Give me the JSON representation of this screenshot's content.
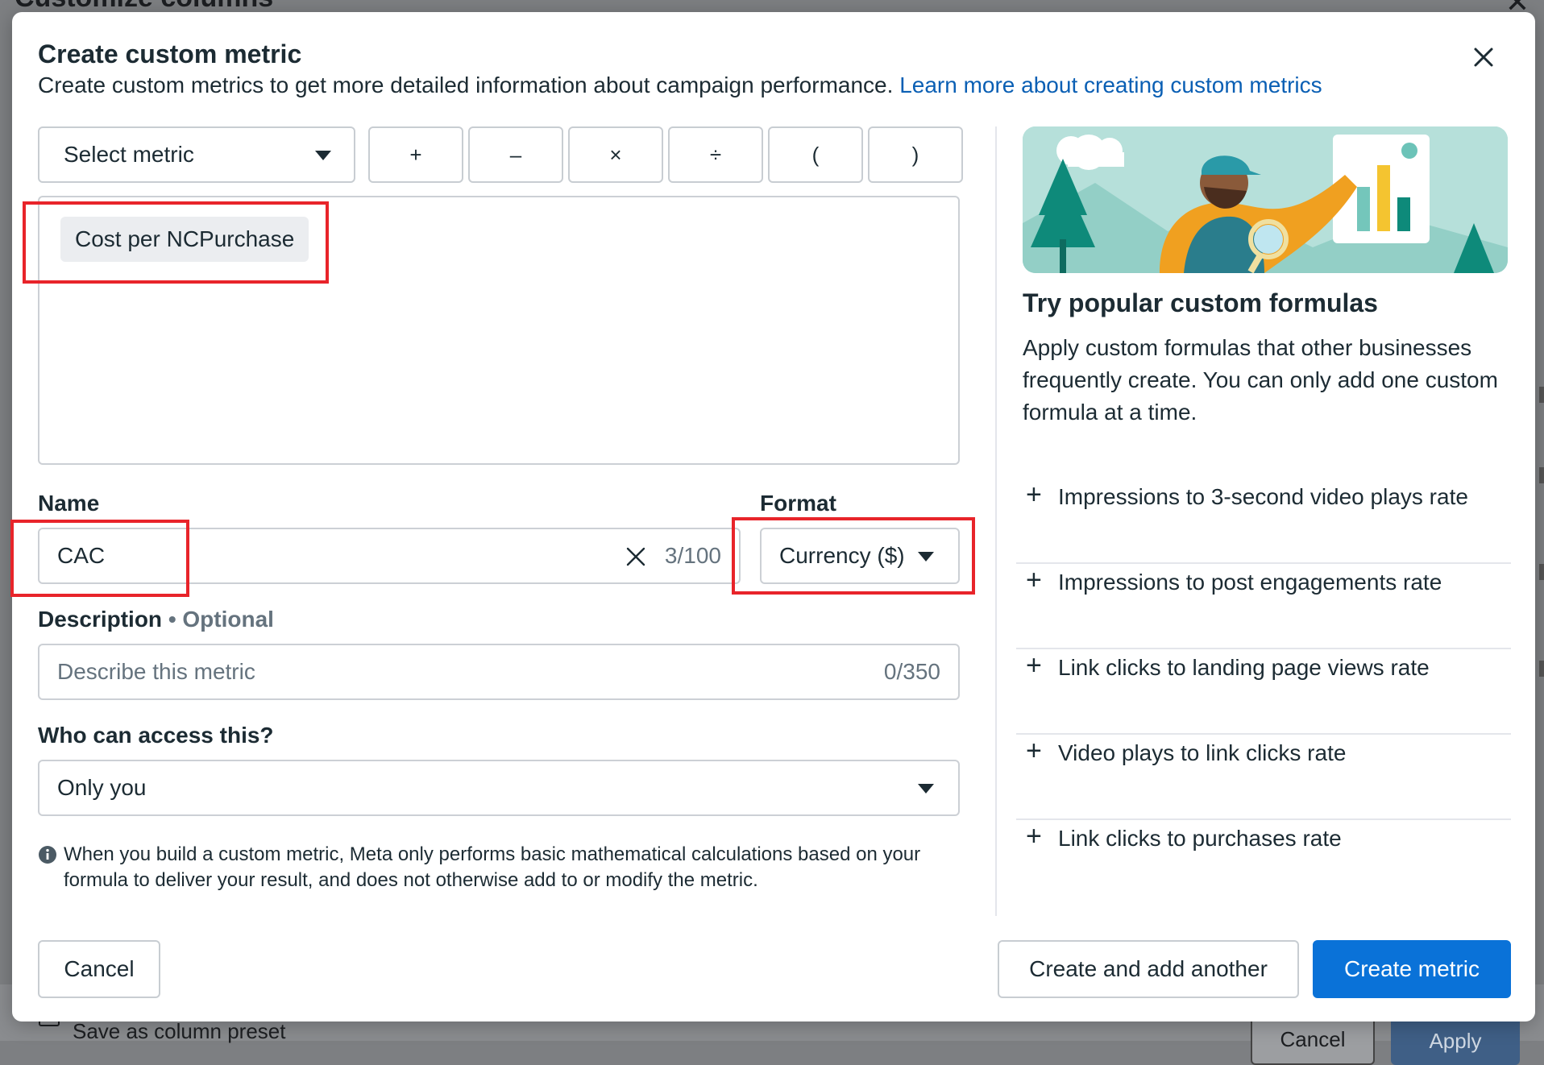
{
  "background": {
    "title": "Customize columns",
    "save_preset_label": "Save as column preset",
    "cancel_label": "Cancel",
    "apply_label": "Apply"
  },
  "modal": {
    "title": "Create custom metric",
    "subtitle": "Create custom metrics to get more detailed information about campaign performance.",
    "learn_more": "Learn more about creating custom metrics"
  },
  "toolbar": {
    "select_metric_label": "Select metric",
    "operators": [
      "+",
      "–",
      "×",
      "÷",
      "(",
      ")"
    ]
  },
  "formula": {
    "chips": [
      "Cost per NCPurchase"
    ]
  },
  "name_field": {
    "label": "Name",
    "value": "CAC",
    "counter": "3/100"
  },
  "format_field": {
    "label": "Format",
    "value": "Currency ($)"
  },
  "description_field": {
    "label": "Description",
    "optional": "Optional",
    "placeholder": "Describe this metric",
    "counter": "0/350"
  },
  "access_field": {
    "label": "Who can access this?",
    "value": "Only you"
  },
  "info_text": "When you build a custom metric, Meta only performs basic mathematical calculations based on your formula to deliver your result, and does not otherwise add to or modify the metric.",
  "popular": {
    "title": "Try popular custom formulas",
    "description": "Apply custom formulas that other businesses frequently create. You can only add one custom formula at a time.",
    "items": [
      "Impressions to 3-second video plays rate",
      "Impressions to post engagements rate",
      "Link clicks to landing page views rate",
      "Video plays to link clicks rate",
      "Link clicks to purchases rate"
    ]
  },
  "footer": {
    "cancel_label": "Cancel",
    "create_another_label": "Create and add another",
    "create_label": "Create metric"
  },
  "colors": {
    "primary": "#0a72d8",
    "link": "#0a5fb4",
    "highlight": "#e8242a"
  }
}
